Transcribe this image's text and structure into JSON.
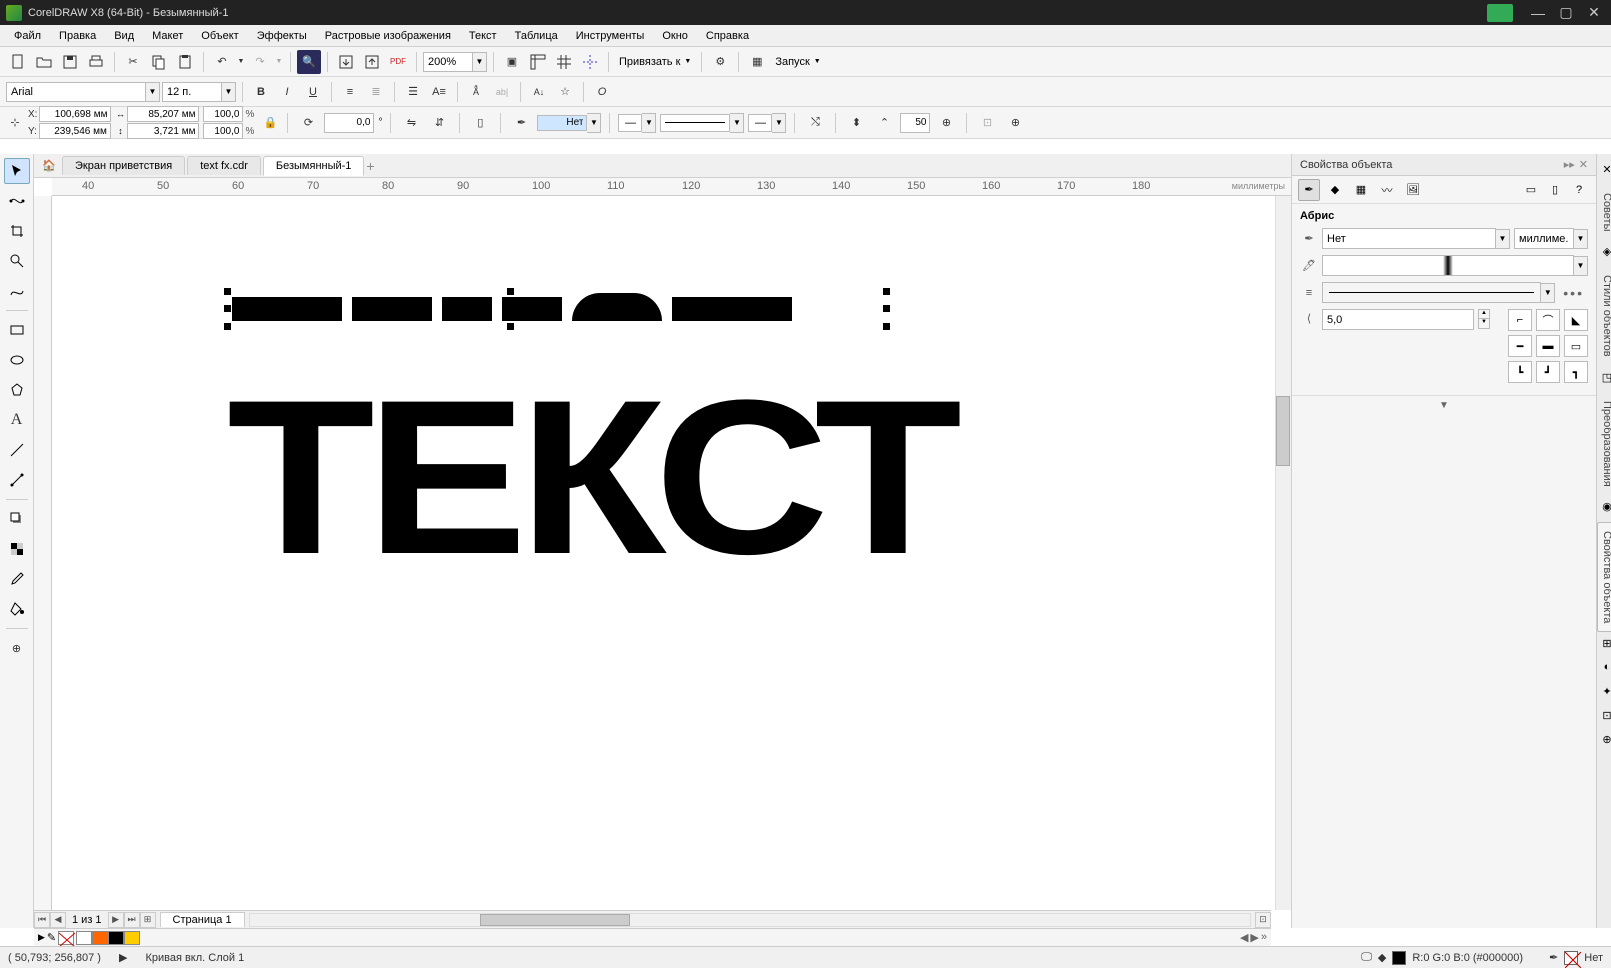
{
  "title": "CorelDRAW X8 (64-Bit) - Безымянный-1",
  "menu": {
    "file": "Файл",
    "edit": "Правка",
    "view": "Вид",
    "layout": "Макет",
    "object": "Объект",
    "effects": "Эффекты",
    "bitmaps": "Растровые изображения",
    "text": "Текст",
    "table": "Таблица",
    "tools": "Инструменты",
    "window": "Окно",
    "help": "Справка"
  },
  "toolbar1": {
    "zoom": "200%",
    "snap_label": "Привязать к",
    "launch_label": "Запуск"
  },
  "textbar": {
    "font": "Arial",
    "size": "12 п."
  },
  "propbar": {
    "x": "100,698 мм",
    "y": "239,546 мм",
    "w": "85,207 мм",
    "h": "3,721 мм",
    "sx": "100,0",
    "sy": "100,0",
    "rot": "0,0",
    "outline_width": "Нет",
    "nodes": "50"
  },
  "doctabs": {
    "welcome": "Экран приветствия",
    "tab1": "text fx.cdr",
    "tab2": "Безымянный-1"
  },
  "ruler": {
    "units": "миллиметры",
    "ticks": [
      "40",
      "50",
      "60",
      "70",
      "80",
      "90",
      "100",
      "110",
      "120",
      "130",
      "140",
      "150",
      "160",
      "170",
      "180"
    ]
  },
  "canvas": {
    "text": "ТЕКСТ"
  },
  "panel": {
    "title": "Свойства объекта",
    "section": "Абрис",
    "outline": "Нет",
    "units": "миллиме...",
    "miter": "5,0"
  },
  "docktabs": {
    "hints": "Советы",
    "styles": "Стили объектов",
    "transform": "Преобразования",
    "props": "Свойства объекта"
  },
  "colors": [
    "#000000",
    "#404040",
    "#808080",
    "#c0c0c0",
    "#ffffff",
    "#400000",
    "#800000",
    "#c04000",
    "#ff0000",
    "#ff8000",
    "#ffc000",
    "#ffff00",
    "#c0ff00",
    "#80ff00",
    "#00ff00",
    "#00ff80",
    "#00ffc0",
    "#00ffff",
    "#00c0ff",
    "#0080ff",
    "#0000ff",
    "#4000c0",
    "#8000ff",
    "#c000ff",
    "#ff00ff",
    "#ff00c0",
    "#ff0080",
    "#c08080",
    "#ffc0c0"
  ],
  "pagebar": {
    "pageinfo": "1  из  1",
    "pagetab": "Страница 1"
  },
  "quickcolors": [
    "#ffffff",
    "#ff6600",
    "#000000",
    "#ffcc00"
  ],
  "status": {
    "cursor": "( 50,793; 256,807 )",
    "object": "Кривая вкл. Слой 1",
    "fill": "R:0 G:0 B:0 (#000000)",
    "outline": "Нет"
  }
}
